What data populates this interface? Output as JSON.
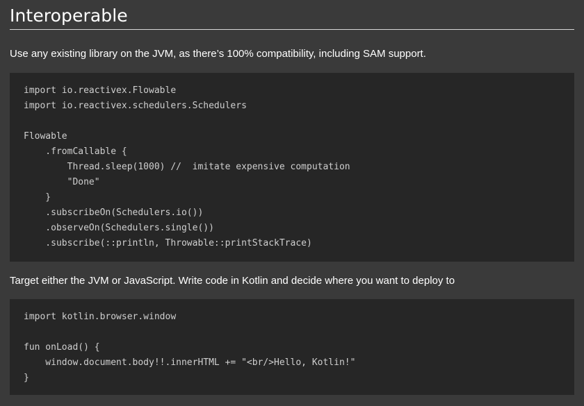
{
  "section": {
    "title": "Interoperable",
    "paragraph_1": "Use any existing library on the JVM, as there’s 100% compatibility, including SAM support.",
    "paragraph_2": "Target either the JVM or JavaScript. Write code in Kotlin and decide where you want to deploy to"
  },
  "code_1": {
    "lines": [
      "import io.reactivex.Flowable",
      "import io.reactivex.schedulers.Schedulers",
      "",
      "Flowable",
      "    .fromCallable {",
      "        Thread.sleep(1000) //  imitate expensive computation",
      "        \"Done\"",
      "    }",
      "    .subscribeOn(Schedulers.io())",
      "    .observeOn(Schedulers.single())",
      "    .subscribe(::println, Throwable::printStackTrace)"
    ]
  },
  "code_2": {
    "lines": [
      "import kotlin.browser.window",
      "",
      "fun onLoad() {",
      "    window.document.body!!.innerHTML += \"<br/>Hello, Kotlin!\"",
      "}"
    ]
  },
  "colors": {
    "page_background": "#3a3a3a",
    "code_background": "#262626",
    "code_text": "#cfcfcf",
    "text": "#ffffff",
    "rule": "#d8d8d8"
  }
}
